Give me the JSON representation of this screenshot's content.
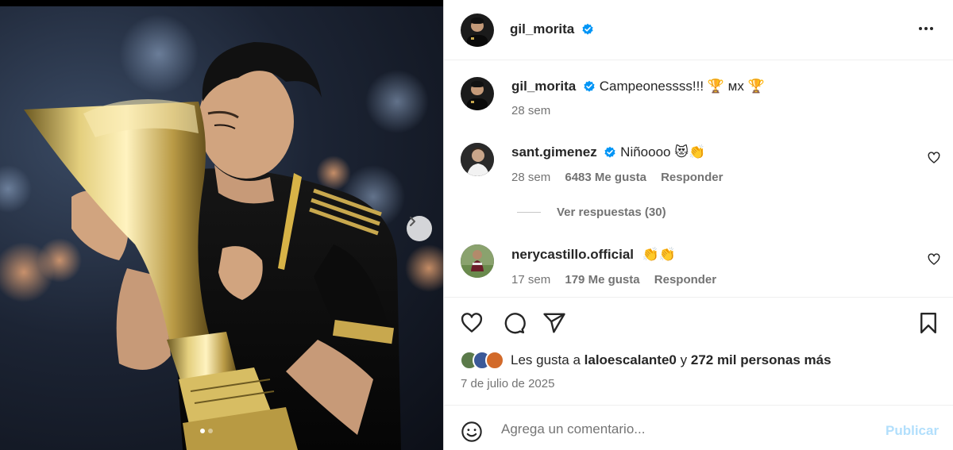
{
  "post": {
    "author": "gil_morita",
    "verified": true,
    "caption_text": "Campeonessss!!! 🏆 мх 🏆",
    "caption_time": "28 sem",
    "image_dots": 2,
    "active_dot": 1
  },
  "comments": [
    {
      "username": "sant.gimenez",
      "verified": true,
      "text": "Niñoooo 😻👏",
      "time": "28 sem",
      "likes": "6483 Me gusta",
      "reply_label": "Responder",
      "view_replies": "Ver respuestas (30)"
    },
    {
      "username": "nerycastillo.official",
      "verified": false,
      "text": "👏👏",
      "time": "17 sem",
      "likes": "179 Me gusta",
      "reply_label": "Responder"
    }
  ],
  "likes_summary": {
    "prefix": "Les gusta a",
    "user": "laloescalante0",
    "connector": "y",
    "rest": "272 mil personas más"
  },
  "date": "7 de julio de 2025",
  "composer": {
    "placeholder": "Agrega un comentario...",
    "post_label": "Publicar"
  },
  "colors": {
    "verified": "#0095f6",
    "muted": "#737373",
    "post_disabled": "#b2dffc"
  },
  "icons": [
    "heart-icon",
    "comment-icon",
    "share-icon",
    "bookmark-icon",
    "smiley-icon",
    "more-icon",
    "chevron-right-icon",
    "verified-badge-icon"
  ]
}
